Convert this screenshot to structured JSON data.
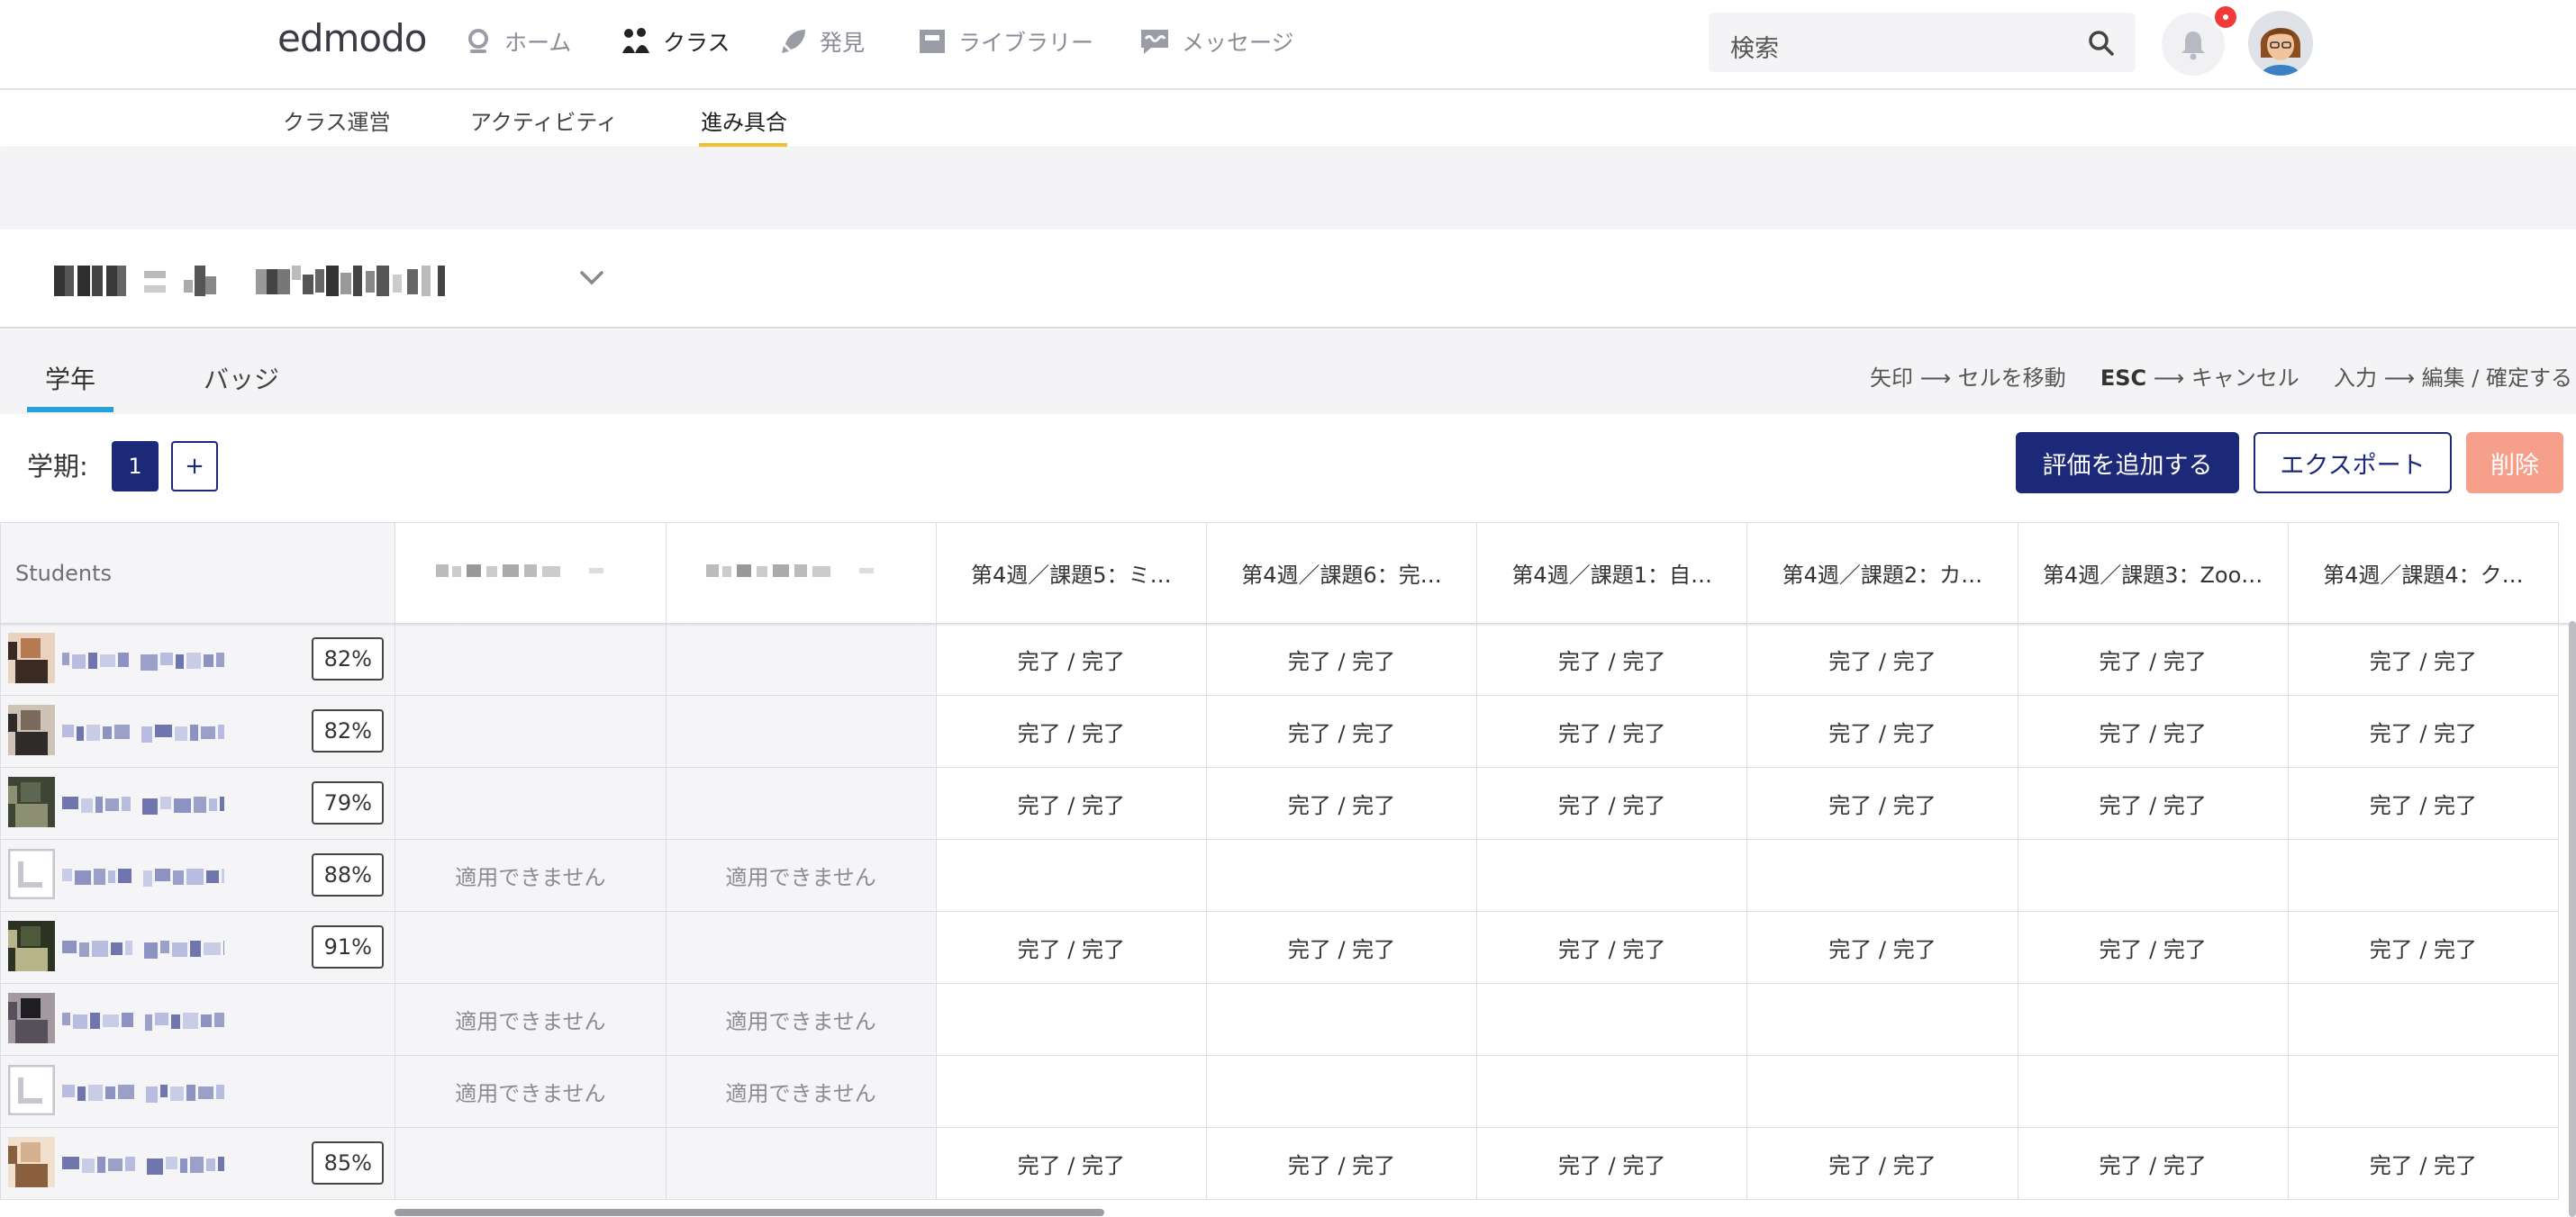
{
  "brand": {
    "logo": "edmodo",
    "accent": "#1c2978",
    "underline_yellow": "#f2c12e",
    "tab_blue": "#27a2d9"
  },
  "nav": [
    {
      "label": "ホーム",
      "icon": "home-icon"
    },
    {
      "label": "クラス",
      "icon": "class-icon"
    },
    {
      "label": "発見",
      "icon": "rocket-icon"
    },
    {
      "label": "ライブラリー",
      "icon": "library-icon"
    },
    {
      "label": "メッセージ",
      "icon": "message-icon"
    }
  ],
  "search": {
    "placeholder": "検索"
  },
  "subnav": [
    {
      "label": "クラス運営"
    },
    {
      "label": "アクティビティ"
    },
    {
      "label": "進み具合"
    }
  ],
  "tabs": [
    {
      "label": "学年"
    },
    {
      "label": "バッジ"
    }
  ],
  "hints": {
    "arrow": "矢印",
    "arrow_action": "セルを移動",
    "esc": "ESC",
    "esc_action": "キャンセル",
    "enter": "入力",
    "enter_action": "編集 / 確定する",
    "sep": "⟶"
  },
  "period": {
    "label": "学期:",
    "current": "1",
    "add": "+"
  },
  "actions": {
    "add_grade": "評価を追加する",
    "export": "エクスポート",
    "delete": "削除"
  },
  "table": {
    "students_header": "Students",
    "columns": [
      "第4週／課題5：ミ…",
      "第4週／課題6：完…",
      "第4週／課題1：自…",
      "第4週／課題2：カ…",
      "第4週／課題3：Zoo…",
      "第4週／課題4：ク…"
    ],
    "done": "完了 / 完了",
    "na": "適用できません",
    "rows": [
      {
        "percent": "82%",
        "na": false,
        "done": true
      },
      {
        "percent": "82%",
        "na": false,
        "done": true
      },
      {
        "percent": "79%",
        "na": false,
        "done": true
      },
      {
        "percent": "88%",
        "na": true,
        "done": false
      },
      {
        "percent": "91%",
        "na": false,
        "done": true
      },
      {
        "percent": "",
        "na": true,
        "done": false
      },
      {
        "percent": "",
        "na": true,
        "done": false
      },
      {
        "percent": "85%",
        "na": false,
        "done": true
      }
    ]
  }
}
